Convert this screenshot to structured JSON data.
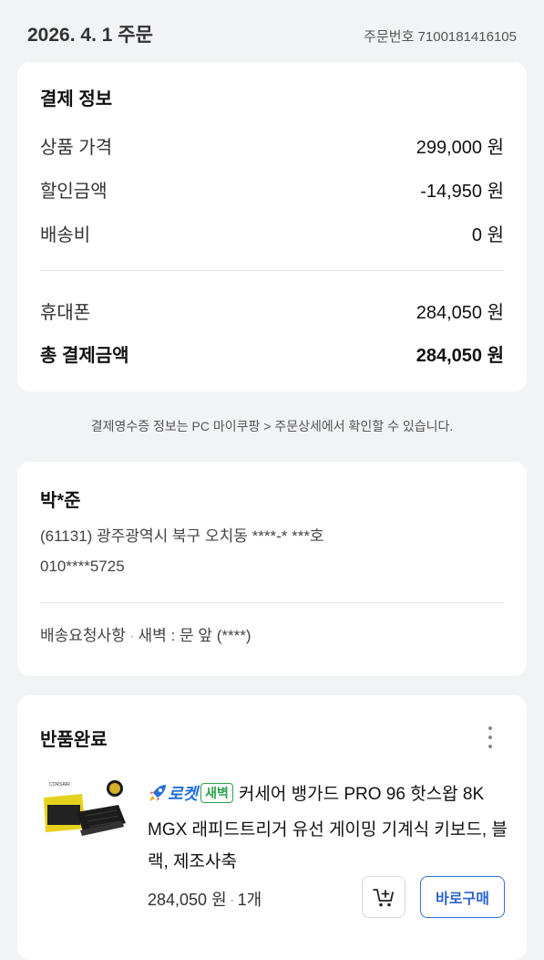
{
  "order": {
    "date": "2026. 4. 1 주문",
    "number": "주문번호 7100181416105"
  },
  "payment": {
    "title": "결제 정보",
    "rows": [
      {
        "label": "상품 가격",
        "value": "299,000 원"
      },
      {
        "label": "할인금액",
        "value": "-14,950 원"
      },
      {
        "label": "배송비",
        "value": "0 원"
      }
    ],
    "method": {
      "label": "휴대폰",
      "value": "284,050 원"
    },
    "total": {
      "label": "총 결제금액",
      "value": "284,050 원"
    }
  },
  "receipt_note": "결제영수증 정보는 PC 마이쿠팡 > 주문상세에서 확인할 수 있습니다.",
  "address": {
    "name": "박*준",
    "line1": "(61131) 광주광역시 북구 오치동 ****-* ***호",
    "phone": "010****5725",
    "request_label": "배송요청사항",
    "separator": "·",
    "request_value": "새벽 : 문 앞 (****)"
  },
  "item": {
    "status": "반품완료",
    "rocket_label": "로켓",
    "dawn_label": "새벽",
    "product_name": "커세어 뱅가드 PRO 96 핫스왑 8K MGX 래피드트리거 유선 게이밍 기계식 키보드, 블랙, 제조사축",
    "price": "284,050 원",
    "separator": "·",
    "quantity": "1개",
    "buy_now_label": "바로구매",
    "thumb_brand": "CORSAIR",
    "icons": {
      "more": "more-vertical-icon",
      "cart": "cart-add-icon",
      "rocket": "rocket-icon"
    }
  },
  "colors": {
    "accent": "#3471d9",
    "rocket": "#1f6fde",
    "dawn": "#2aa34b",
    "background": "#f2f3f5"
  }
}
